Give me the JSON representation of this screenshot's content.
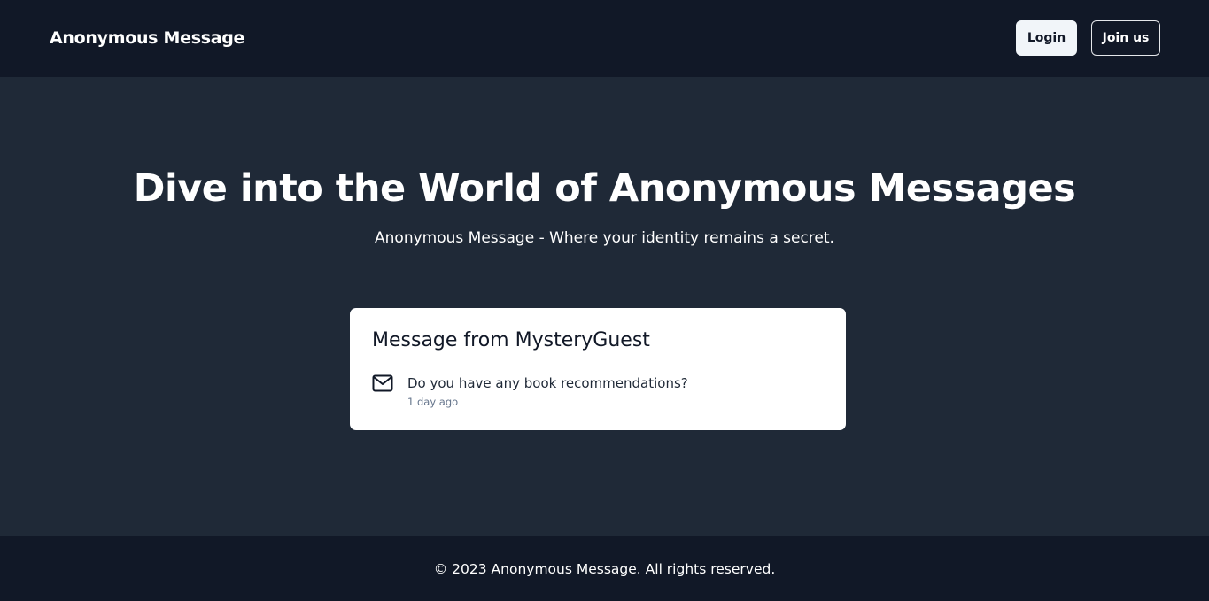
{
  "navbar": {
    "brand": "Anonymous Message",
    "login_label": "Login",
    "join_label": "Join us"
  },
  "hero": {
    "title": "Dive into the World of Anonymous Messages",
    "subtitle": "Anonymous Message - Where your identity remains a secret."
  },
  "message_card": {
    "title": "Message from MysteryGuest",
    "icon": "mail-icon",
    "text": "Do you have any book recommendations?",
    "time": "1 day ago"
  },
  "footer": {
    "text": "© 2023 Anonymous Message. All rights reserved."
  },
  "colors": {
    "navbar_bg": "#111827",
    "page_bg": "#1f2937",
    "card_bg": "#ffffff",
    "muted_text": "#64748b"
  }
}
